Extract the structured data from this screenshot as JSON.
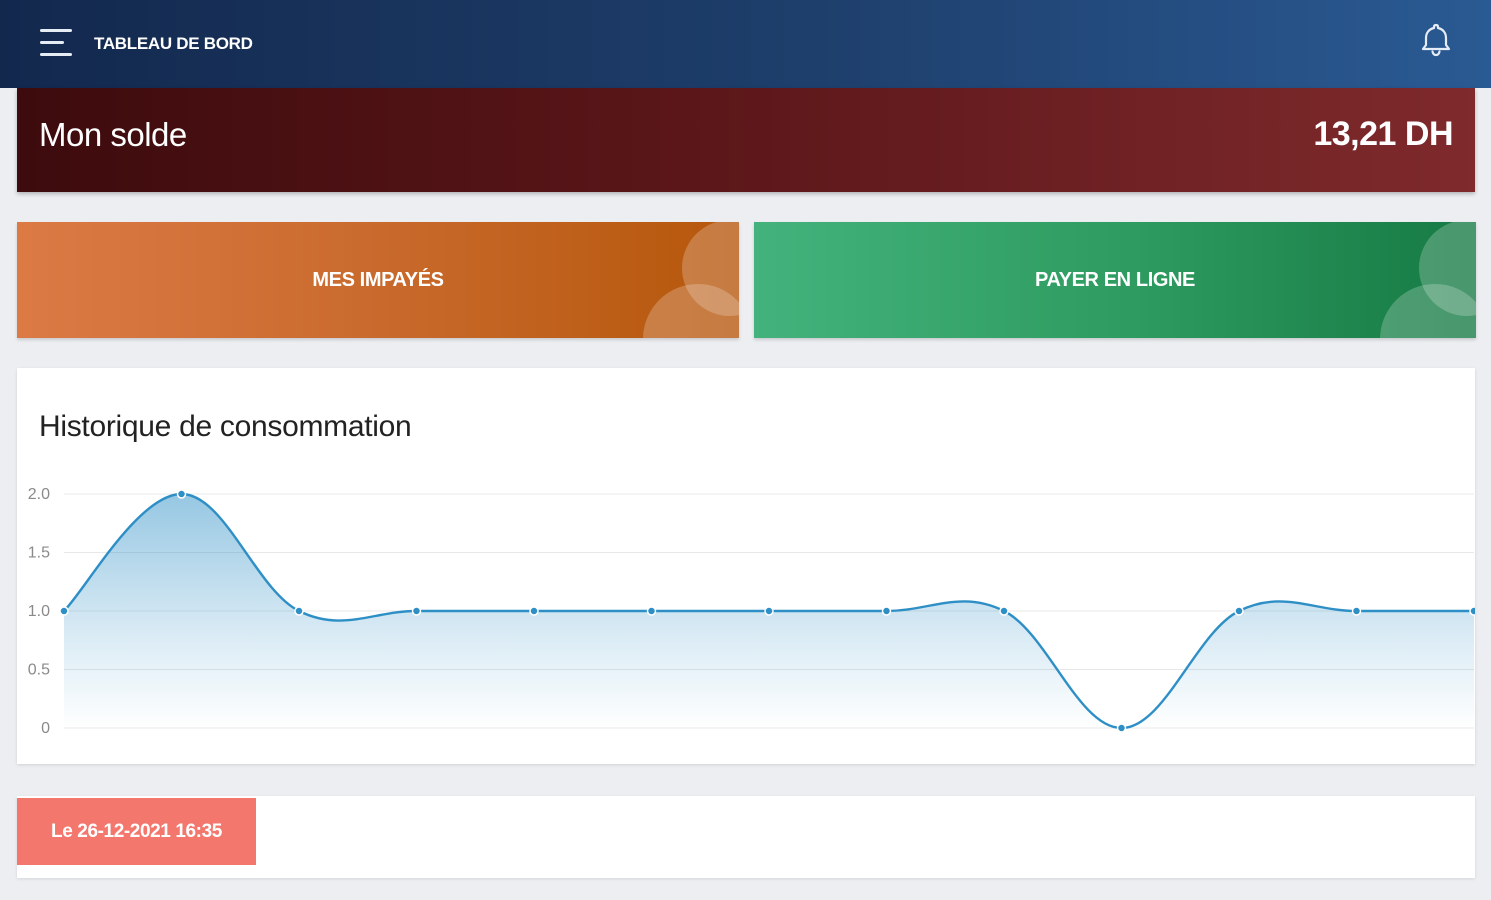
{
  "header": {
    "title": "TABLEAU DE BORD",
    "menu_icon": "hamburger-menu-icon",
    "notification_icon": "bell-icon"
  },
  "balance": {
    "label": "Mon solde",
    "value": "13,21 DH"
  },
  "actions": {
    "impayes_label": "MES IMPAYÉS",
    "payer_label": "PAYER EN LIGNE"
  },
  "colors": {
    "header": "#1e3f6c",
    "balance": "#5a1619",
    "impayes": "#c96a2d",
    "payer": "#2f9d61",
    "line": "#2e8fc6",
    "date_badge": "#f4776e"
  },
  "chart": {
    "title": "Historique de consommation"
  },
  "chart_data": {
    "type": "area",
    "title": "Historique de consommation",
    "xlabel": "",
    "ylabel": "",
    "ylim": [
      0,
      2
    ],
    "yticks": [
      "0",
      "0.5",
      "1.0",
      "1.5",
      "2.0"
    ],
    "grid": true,
    "smooth": true,
    "series": [
      {
        "values": [
          1,
          2,
          1,
          1,
          1,
          1,
          1,
          1,
          1,
          0,
          1,
          1,
          1
        ]
      }
    ]
  },
  "last_update": {
    "label": "Le 26-12-2021 16:35"
  }
}
